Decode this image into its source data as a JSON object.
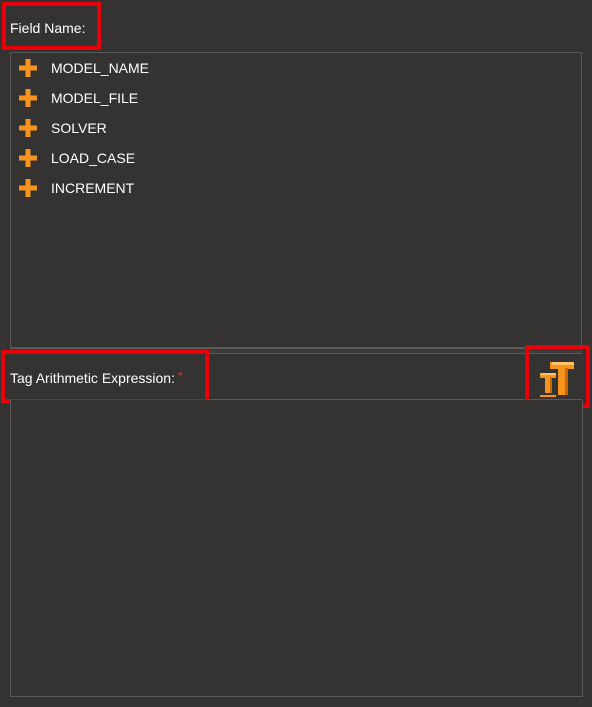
{
  "field_name": {
    "label": "Field Name:"
  },
  "tree": {
    "items": [
      {
        "label": "MODEL_NAME",
        "icon": "plus-expand-icon"
      },
      {
        "label": "MODEL_FILE",
        "icon": "plus-expand-icon"
      },
      {
        "label": "SOLVER",
        "icon": "plus-expand-icon"
      },
      {
        "label": "LOAD_CASE",
        "icon": "plus-expand-icon"
      },
      {
        "label": "INCREMENT",
        "icon": "plus-expand-icon"
      }
    ]
  },
  "expression": {
    "label": "Tag Arithmetic Expression:",
    "required_marker": "*",
    "value": ""
  },
  "tag_button": {
    "icon": "tag-tt-icon"
  },
  "colors": {
    "background": "#343332",
    "text": "#ffffff",
    "accent_orange": "#f7941d",
    "callout_red": "#e8000b",
    "required": "#e0302a"
  }
}
